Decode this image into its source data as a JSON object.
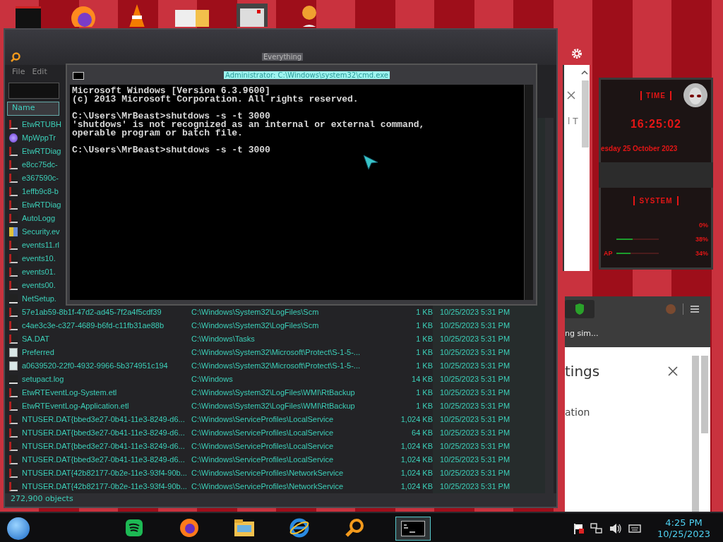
{
  "everything": {
    "title": "Everything",
    "menu": [
      "File",
      "Edit"
    ],
    "columns": [
      "Name"
    ],
    "rows": [
      {
        "kind": "log",
        "name": "EtwRTUBH"
      },
      {
        "kind": "gem",
        "name": "MpWppTr"
      },
      {
        "kind": "log",
        "name": "EtwRTDiag"
      },
      {
        "kind": "log",
        "name": "e8cc75dc-"
      },
      {
        "kind": "log",
        "name": "e367590c-"
      },
      {
        "kind": "log",
        "name": "1effb9c8-b"
      },
      {
        "kind": "log",
        "name": "EtwRTDiag"
      },
      {
        "kind": "log",
        "name": "AutoLogg"
      },
      {
        "kind": "book",
        "name": "Security.ev"
      },
      {
        "kind": "log",
        "name": "events11.rl"
      },
      {
        "kind": "log",
        "name": "events10."
      },
      {
        "kind": "log",
        "name": "events01."
      },
      {
        "kind": "log",
        "name": "events00."
      },
      {
        "kind": "text",
        "name": "NetSetup."
      },
      {
        "kind": "log",
        "name": "57e1ab59-8b1f-47d2-ad45-7f2a4f5cdf39",
        "path": "C:\\Windows\\System32\\LogFiles\\Scm",
        "size": "1 KB",
        "modified": "10/25/2023 5:31 PM"
      },
      {
        "kind": "log",
        "name": "c4ae3c3e-c327-4689-b6fd-c11fb31ae88b",
        "path": "C:\\Windows\\System32\\LogFiles\\Scm",
        "size": "1 KB",
        "modified": "10/25/2023 5:31 PM"
      },
      {
        "kind": "log",
        "name": "SA.DAT",
        "path": "C:\\Windows\\Tasks",
        "size": "1 KB",
        "modified": "10/25/2023 5:31 PM"
      },
      {
        "kind": "page",
        "name": "Preferred",
        "path": "C:\\Windows\\System32\\Microsoft\\Protect\\S-1-5-...",
        "size": "1 KB",
        "modified": "10/25/2023 5:31 PM"
      },
      {
        "kind": "page",
        "name": "a0639520-22f0-4932-9966-5b374951c194",
        "path": "C:\\Windows\\System32\\Microsoft\\Protect\\S-1-5-...",
        "size": "1 KB",
        "modified": "10/25/2023 5:31 PM"
      },
      {
        "kind": "text",
        "name": "setupact.log",
        "path": "C:\\Windows",
        "size": "14 KB",
        "modified": "10/25/2023 5:31 PM"
      },
      {
        "kind": "log",
        "name": "EtwRTEventLog-System.etl",
        "path": "C:\\Windows\\System32\\LogFiles\\WMI\\RtBackup",
        "size": "1 KB",
        "modified": "10/25/2023 5:31 PM"
      },
      {
        "kind": "log",
        "name": "EtwRTEventLog-Application.etl",
        "path": "C:\\Windows\\System32\\LogFiles\\WMI\\RtBackup",
        "size": "1 KB",
        "modified": "10/25/2023 5:31 PM"
      },
      {
        "kind": "log",
        "name": "NTUSER.DAT{bbed3e27-0b41-11e3-8249-d6...",
        "path": "C:\\Windows\\ServiceProfiles\\LocalService",
        "size": "1,024 KB",
        "modified": "10/25/2023 5:31 PM"
      },
      {
        "kind": "log",
        "name": "NTUSER.DAT{bbed3e27-0b41-11e3-8249-d6...",
        "path": "C:\\Windows\\ServiceProfiles\\LocalService",
        "size": "64 KB",
        "modified": "10/25/2023 5:31 PM"
      },
      {
        "kind": "log",
        "name": "NTUSER.DAT{bbed3e27-0b41-11e3-8249-d6...",
        "path": "C:\\Windows\\ServiceProfiles\\LocalService",
        "size": "1,024 KB",
        "modified": "10/25/2023 5:31 PM"
      },
      {
        "kind": "log",
        "name": "NTUSER.DAT{bbed3e27-0b41-11e3-8249-d6...",
        "path": "C:\\Windows\\ServiceProfiles\\LocalService",
        "size": "1,024 KB",
        "modified": "10/25/2023 5:31 PM"
      },
      {
        "kind": "log",
        "name": "NTUSER.DAT{42b82177-0b2e-11e3-93f4-90b...",
        "path": "C:\\Windows\\ServiceProfiles\\NetworkService",
        "size": "1,024 KB",
        "modified": "10/25/2023 5:31 PM"
      },
      {
        "kind": "log",
        "name": "NTUSER.DAT{42b82177-0b2e-11e3-93f4-90b...",
        "path": "C:\\Windows\\ServiceProfiles\\NetworkService",
        "size": "1,024 KB",
        "modified": "10/25/2023 5:31 PM"
      }
    ],
    "status": "272,900 objects"
  },
  "cmd": {
    "title": "Administrator: C:\\Windows\\system32\\cmd.exe",
    "blocks": [
      [
        "Microsoft Windows [Version 6.3.9600]",
        "(c) 2013 Microsoft Corporation. All rights reserved."
      ],
      [
        "C:\\Users\\MrBeast>shutdows -s -t 3000",
        "'shutdows' is not recognized as an internal or external command,",
        "operable program or batch file."
      ],
      [
        "C:\\Users\\MrBeast>shutdows -s -t 3000"
      ]
    ]
  },
  "back_browser": {
    "text": "l T"
  },
  "widget": {
    "time_title": "TIME",
    "time": "16:25:02",
    "date": "esday 25 October 2023",
    "system_title": "SYSTEM",
    "meters": [
      {
        "reading": "0%"
      },
      {
        "reading": "38%",
        "level": 0.38
      },
      {
        "label": "AP",
        "reading": "34%",
        "level": 0.34
      }
    ]
  },
  "browser": {
    "tab_text": "ng sim...",
    "heading": "tings",
    "item": "ation"
  },
  "taskbar": {
    "apps": [
      {
        "kind": "music",
        "selected": false
      },
      {
        "kind": "firefox",
        "selected": false
      },
      {
        "kind": "folder",
        "selected": false
      },
      {
        "kind": "ie",
        "selected": false
      },
      {
        "kind": "search",
        "selected": false
      },
      {
        "kind": "terminal",
        "selected": true
      }
    ],
    "time": "4:25 PM",
    "date": "10/25/2023"
  }
}
